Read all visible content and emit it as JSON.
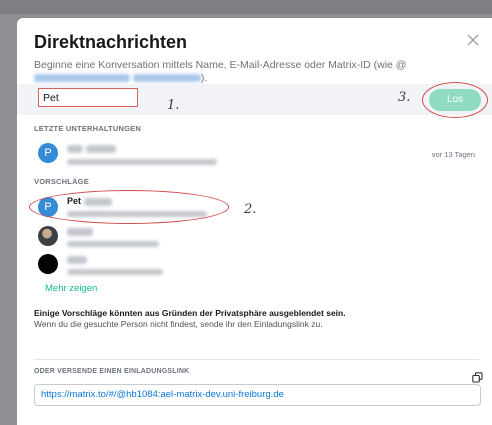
{
  "dialog": {
    "title": "Direktnachrichten",
    "subtitle_prefix": "Beginne eine Konversation mittels Name, E-Mail-Adresse oder Matrix-ID (wie @",
    "subtitle_suffix": ").",
    "close_icon": "close-icon"
  },
  "search": {
    "value": "Pet",
    "go_label": "Los"
  },
  "annotations": {
    "step1": "1.",
    "step2": "2.",
    "step3": "3."
  },
  "recent": {
    "label": "LETZTE UNTERHALTUNGEN",
    "items": [
      {
        "name_visible": "Pet",
        "avatar_letter": "P",
        "timestamp": "vor 13 Tagen"
      }
    ]
  },
  "suggestions": {
    "label": "VORSCHLÄGE",
    "items": [
      {
        "name_visible": "Pet",
        "avatar_letter": "P"
      },
      {
        "name_visible": ""
      },
      {
        "name_visible": ""
      }
    ],
    "more_label": "Mehr zeigen"
  },
  "privacy_note": {
    "bold": "Einige Vorschläge könnten aus Gründen der Privatsphäre ausgeblendet sein.",
    "normal": "Wenn du die gesuchte Person nicht findest, sende ihr den Einladungslink zu."
  },
  "invite": {
    "label": "ODER VERSENDE EINEN EINLADUNGSLINK",
    "link": "https://matrix.to/#/@hb1084:ael-matrix-dev.uni-freiburg.de",
    "copy_icon": "copy-icon"
  },
  "colors": {
    "accent_green": "#0dbd8b",
    "go_button_disabled": "#8fdbbf",
    "avatar_blue": "#368bd6",
    "annotation_red": "#d34a4a",
    "link_blue": "#0b76d8"
  }
}
